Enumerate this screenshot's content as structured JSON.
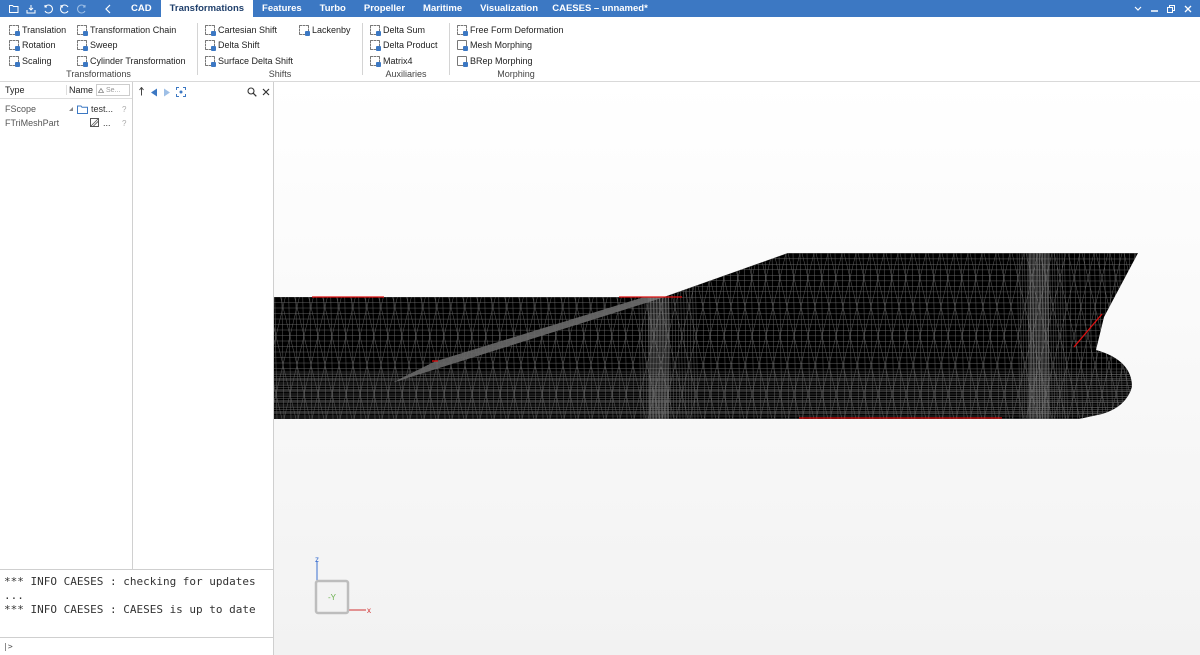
{
  "window": {
    "title": "CAESES – unnamed*"
  },
  "tabs": [
    {
      "label": "CAD",
      "active": false
    },
    {
      "label": "Transformations",
      "active": true
    },
    {
      "label": "Features",
      "active": false
    },
    {
      "label": "Turbo",
      "active": false
    },
    {
      "label": "Propeller",
      "active": false
    },
    {
      "label": "Maritime",
      "active": false
    },
    {
      "label": "Visualization",
      "active": false
    }
  ],
  "ribbon": {
    "transformations": {
      "label": "Transformations",
      "col1": [
        "Translation",
        "Rotation",
        "Scaling"
      ],
      "col2": [
        "Transformation Chain",
        "Sweep",
        "Cylinder Transformation"
      ]
    },
    "shifts": {
      "label": "Shifts",
      "col1": [
        "Cartesian Shift",
        "Delta Shift",
        "Surface Delta Shift"
      ],
      "col2": [
        "Lackenby"
      ]
    },
    "auxiliaries": {
      "label": "Auxiliaries",
      "col1": [
        "Delta Sum",
        "Delta Product",
        "Matrix4"
      ]
    },
    "morphing": {
      "label": "Morphing",
      "col1": [
        "Free Form Deformation",
        "Mesh Morphing",
        "BRep Morphing"
      ]
    }
  },
  "tree": {
    "header": {
      "type": "Type",
      "name": "Name",
      "search_placeholder": "Se..."
    },
    "rows": [
      {
        "type": "FScope",
        "name": "test...",
        "q": "?"
      },
      {
        "type": "FTriMeshPart",
        "name": "...",
        "q": "?"
      }
    ]
  },
  "console": {
    "lines": [
      "*** INFO CAESES : checking for updates",
      "...",
      "*** INFO CAESES : CAESES is up to date"
    ],
    "prompt": "|>"
  },
  "viewport": {
    "axis_labels": {
      "up": "z",
      "right": "x",
      "center": "-Y"
    },
    "colors": {
      "mesh": "#000000",
      "edge": "#e01010",
      "axis_z": "#3a6fd0",
      "axis_x": "#d03030",
      "cube_label": "#6ab04c"
    }
  }
}
